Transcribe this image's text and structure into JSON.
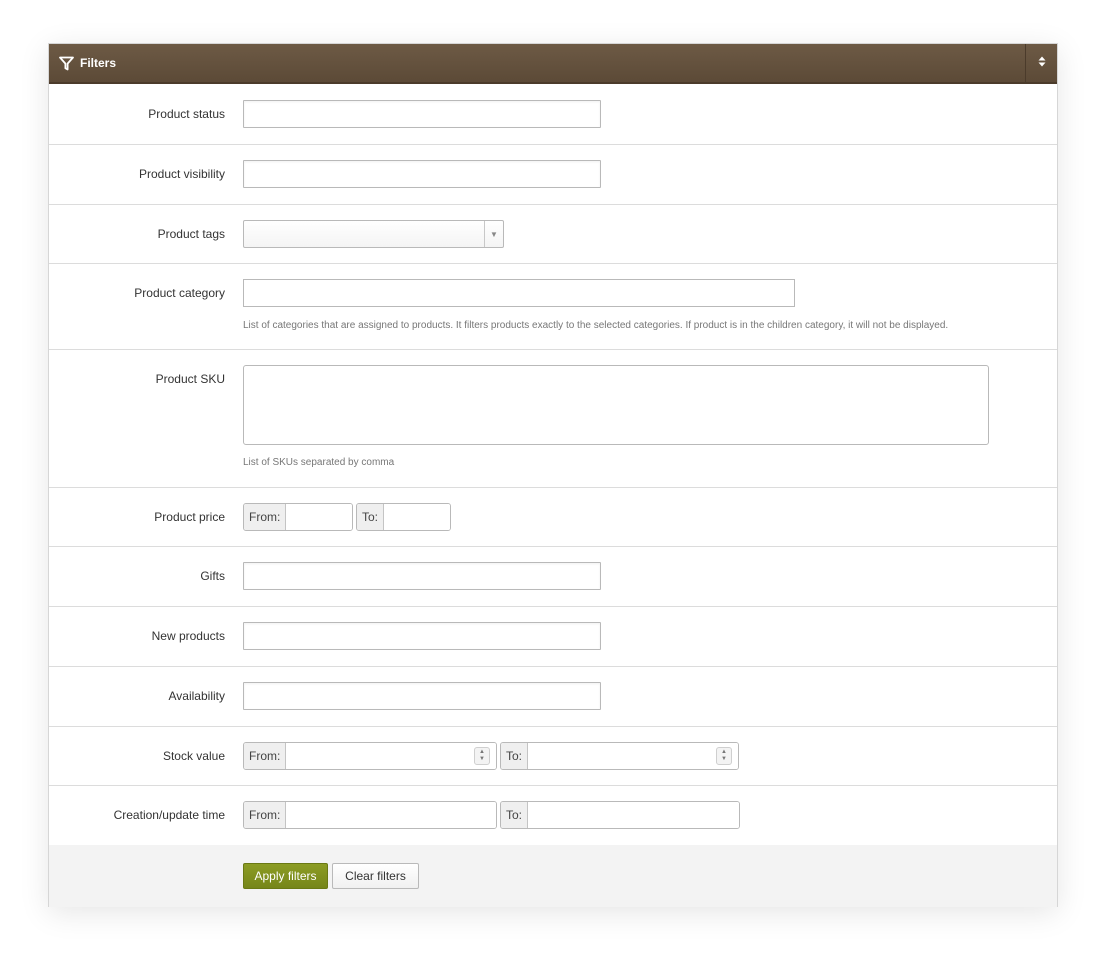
{
  "panel": {
    "title": "Filters",
    "filter_icon": "filter-icon",
    "toggle_icon": "sort-toggle-icon"
  },
  "filters": {
    "product_status": {
      "label": "Product status",
      "value": ""
    },
    "product_visibility": {
      "label": "Product visibility",
      "value": ""
    },
    "product_tags": {
      "label": "Product tags",
      "value": ""
    },
    "product_category": {
      "label": "Product category",
      "value": "",
      "help": "List of categories that are assigned to products. It filters products exactly to the selected categories. If product is in the children category, it will not be displayed."
    },
    "product_sku": {
      "label": "Product SKU",
      "value": "",
      "help": "List of SKUs separated by comma"
    },
    "product_price": {
      "label": "Product price",
      "from_label": "From:",
      "to_label": "To:",
      "from_value": "",
      "to_value": ""
    },
    "gifts": {
      "label": "Gifts",
      "value": ""
    },
    "new_products": {
      "label": "New products",
      "value": ""
    },
    "availability": {
      "label": "Availability",
      "value": ""
    },
    "stock_value": {
      "label": "Stock value",
      "from_label": "From:",
      "to_label": "To:",
      "from_value": "",
      "to_value": ""
    },
    "creation_time": {
      "label": "Creation/update time",
      "from_label": "From:",
      "to_label": "To:",
      "from_value": "",
      "to_value": ""
    }
  },
  "actions": {
    "apply_label": "Apply filters",
    "clear_label": "Clear filters"
  },
  "colors": {
    "header_bg": "#5c4a37",
    "apply_button": "#7b8b1c"
  }
}
